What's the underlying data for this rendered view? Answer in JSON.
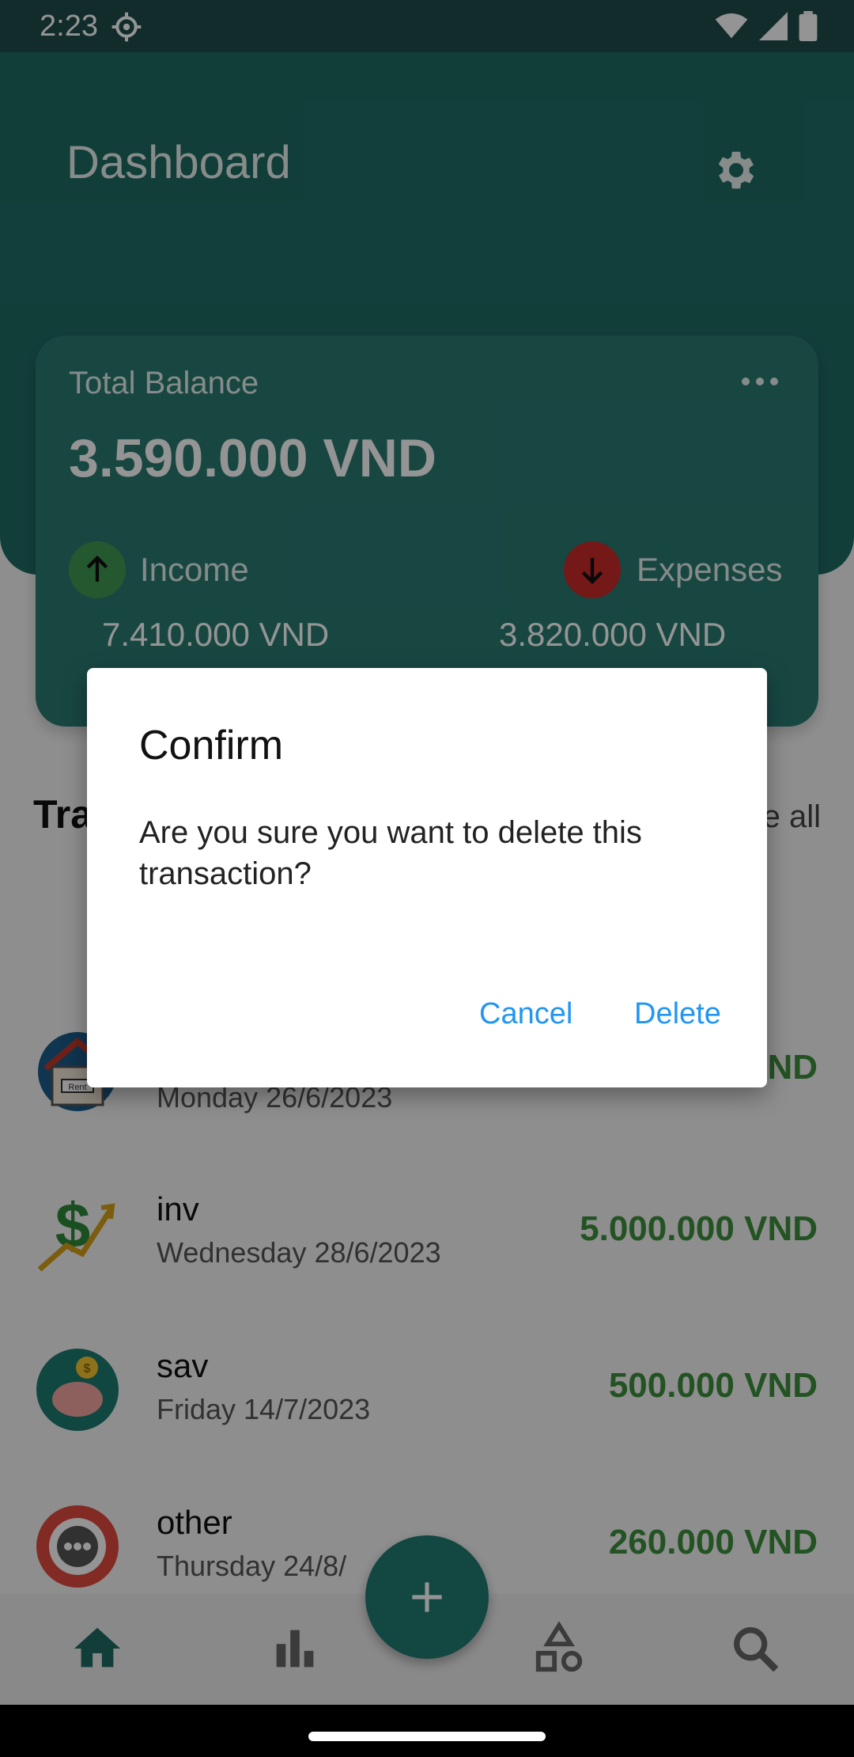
{
  "status_bar": {
    "time": "2:23"
  },
  "header": {
    "title": "Dashboard"
  },
  "balance": {
    "label": "Total Balance",
    "amount": "3.590.000 VND",
    "income_label": "Income",
    "income_value": "7.410.000 VND",
    "expenses_label": "Expenses",
    "expenses_value": "3.820.000 VND"
  },
  "transactions": {
    "title": "Tra",
    "see_all": "e all",
    "items": [
      {
        "name": "",
        "date": "Monday  26/6/2023",
        "amount": "ND",
        "icon": "rent-house-icon"
      },
      {
        "name": "inv",
        "date": "Wednesday  28/6/2023",
        "amount": "5.000.000 VND",
        "icon": "investment-icon"
      },
      {
        "name": "sav",
        "date": "Friday  14/7/2023",
        "amount": "500.000 VND",
        "icon": "piggy-bank-icon"
      },
      {
        "name": "other",
        "date": "Thursday  24/8/",
        "amount": "260.000 VND",
        "icon": "more-icon"
      }
    ]
  },
  "dialog": {
    "title": "Confirm",
    "message": "Are you sure you want to delete this transaction?",
    "cancel": "Cancel",
    "delete": "Delete"
  },
  "colors": {
    "header": "#1f6b65",
    "card": "#2a7a73",
    "income": "#3e9a52",
    "expense": "#c92a2a",
    "amount_green": "#3d8f3d",
    "dialog_button": "#2196f3"
  }
}
